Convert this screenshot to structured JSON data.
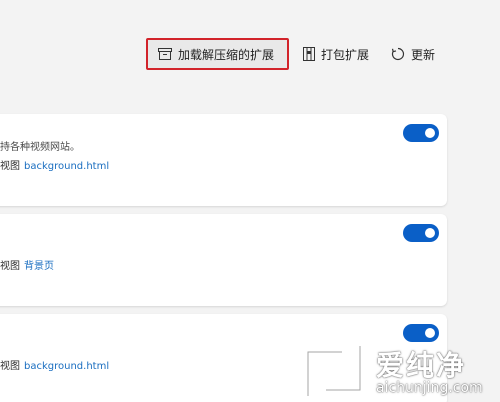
{
  "toolbar": {
    "load_unpacked": {
      "label": "加载解压缩的扩展",
      "icon": "archive-box-icon"
    },
    "pack": {
      "label": "打包扩展",
      "icon": "package-icon"
    },
    "refresh": {
      "label": "更新",
      "icon": "refresh-icon"
    }
  },
  "extensions": [
    {
      "description": "持各种视频网站。",
      "inspect_prefix": "视图",
      "inspect_link": "background.html",
      "enabled": true
    },
    {
      "description": "",
      "inspect_prefix": "视图",
      "inspect_link": "背景页",
      "enabled": true
    },
    {
      "description": "",
      "inspect_prefix": "视图",
      "inspect_link": "background.html",
      "enabled": true
    }
  ],
  "watermark": {
    "title": "爱纯净",
    "url": "aichunjing.com"
  },
  "colors": {
    "accent": "#0a5fc7",
    "link": "#1a6ec0",
    "highlight_border": "#d2232a",
    "background": "#f3f3f3"
  }
}
